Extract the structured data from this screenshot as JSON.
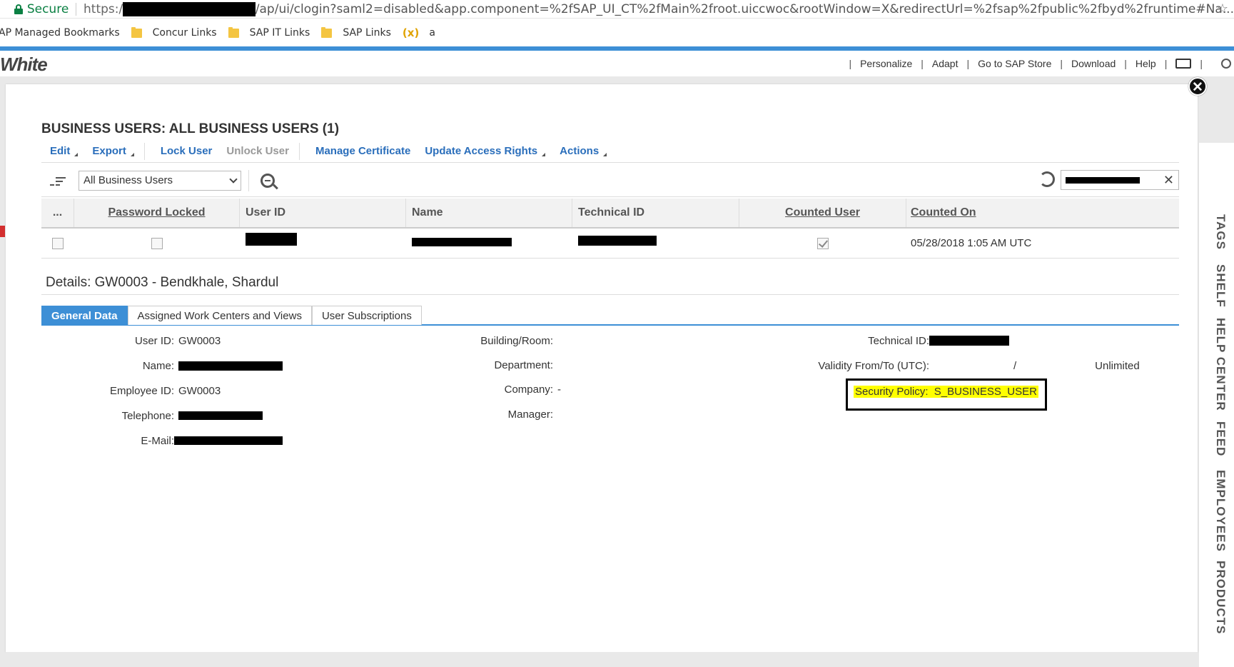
{
  "browser": {
    "secure_label": "Secure",
    "url_prefix": "https:/",
    "url_rest": "/ap/ui/clogin?saml2=disabled&app.component=%2fSAP_UI_CT%2fMain%2froot.uiccwoc&rootWindow=X&redirectUrl=%2fsap%2fpublic%2fbyd%2fruntime#Na..."
  },
  "bookmarks": [
    {
      "label": "AP Managed Bookmarks"
    },
    {
      "label": "Concur Links"
    },
    {
      "label": "SAP IT Links"
    },
    {
      "label": "SAP Links"
    },
    {
      "label": "a"
    }
  ],
  "bookmark_var_icon": "(x)",
  "app": {
    "brand": "White",
    "nav": [
      "Personalize",
      "Adapt",
      "Go to SAP Store",
      "Download",
      "Help"
    ]
  },
  "page": {
    "title": "BUSINESS USERS: ALL BUSINESS USERS (1)",
    "toolbar": {
      "edit": "Edit",
      "export": "Export",
      "lock": "Lock User",
      "unlock": "Unlock User",
      "manage_cert": "Manage Certificate",
      "update_rights": "Update Access Rights",
      "actions": "Actions"
    },
    "filter": {
      "selected": "All Business Users"
    },
    "table": {
      "headers": {
        "more": "...",
        "password_locked": "Password Locked",
        "user_id": "User ID",
        "name": "Name",
        "technical_id": "Technical ID",
        "counted_user": "Counted User",
        "counted_on": "Counted On"
      },
      "rows": [
        {
          "counted_user": true,
          "counted_on": "05/28/2018 1:05 AM UTC"
        }
      ]
    },
    "details": {
      "title": "Details: GW0003 - Bendkhale, Shardul",
      "tabs": [
        "General Data",
        "Assigned Work Centers and Views",
        "User Subscriptions"
      ],
      "user_id_label": "User ID:",
      "user_id_value": "GW0003",
      "name_label": "Name:",
      "employee_id_label": "Employee ID:",
      "employee_id_value": "GW0003",
      "telephone_label": "Telephone:",
      "email_label": "E-Mail:",
      "building_label": "Building/Room:",
      "department_label": "Department:",
      "company_label": "Company:",
      "company_value": "-",
      "manager_label": "Manager:",
      "technical_id_label": "Technical ID:",
      "validity_label": "Validity From/To (UTC):",
      "validity_sep": "/",
      "validity_to": "Unlimited",
      "security_policy_label": "Security Policy:",
      "security_policy_value": "S_BUSINESS_USER"
    }
  },
  "side_tabs": [
    "TAGS",
    "SHELF",
    "HELP CENTER",
    "FEED",
    "EMPLOYEES",
    "PRODUCTS"
  ],
  "colors": {
    "accent": "#3d8fd6",
    "link": "#2a6ebb",
    "highlight": "#ffff00",
    "secure_green": "#0b8043"
  }
}
